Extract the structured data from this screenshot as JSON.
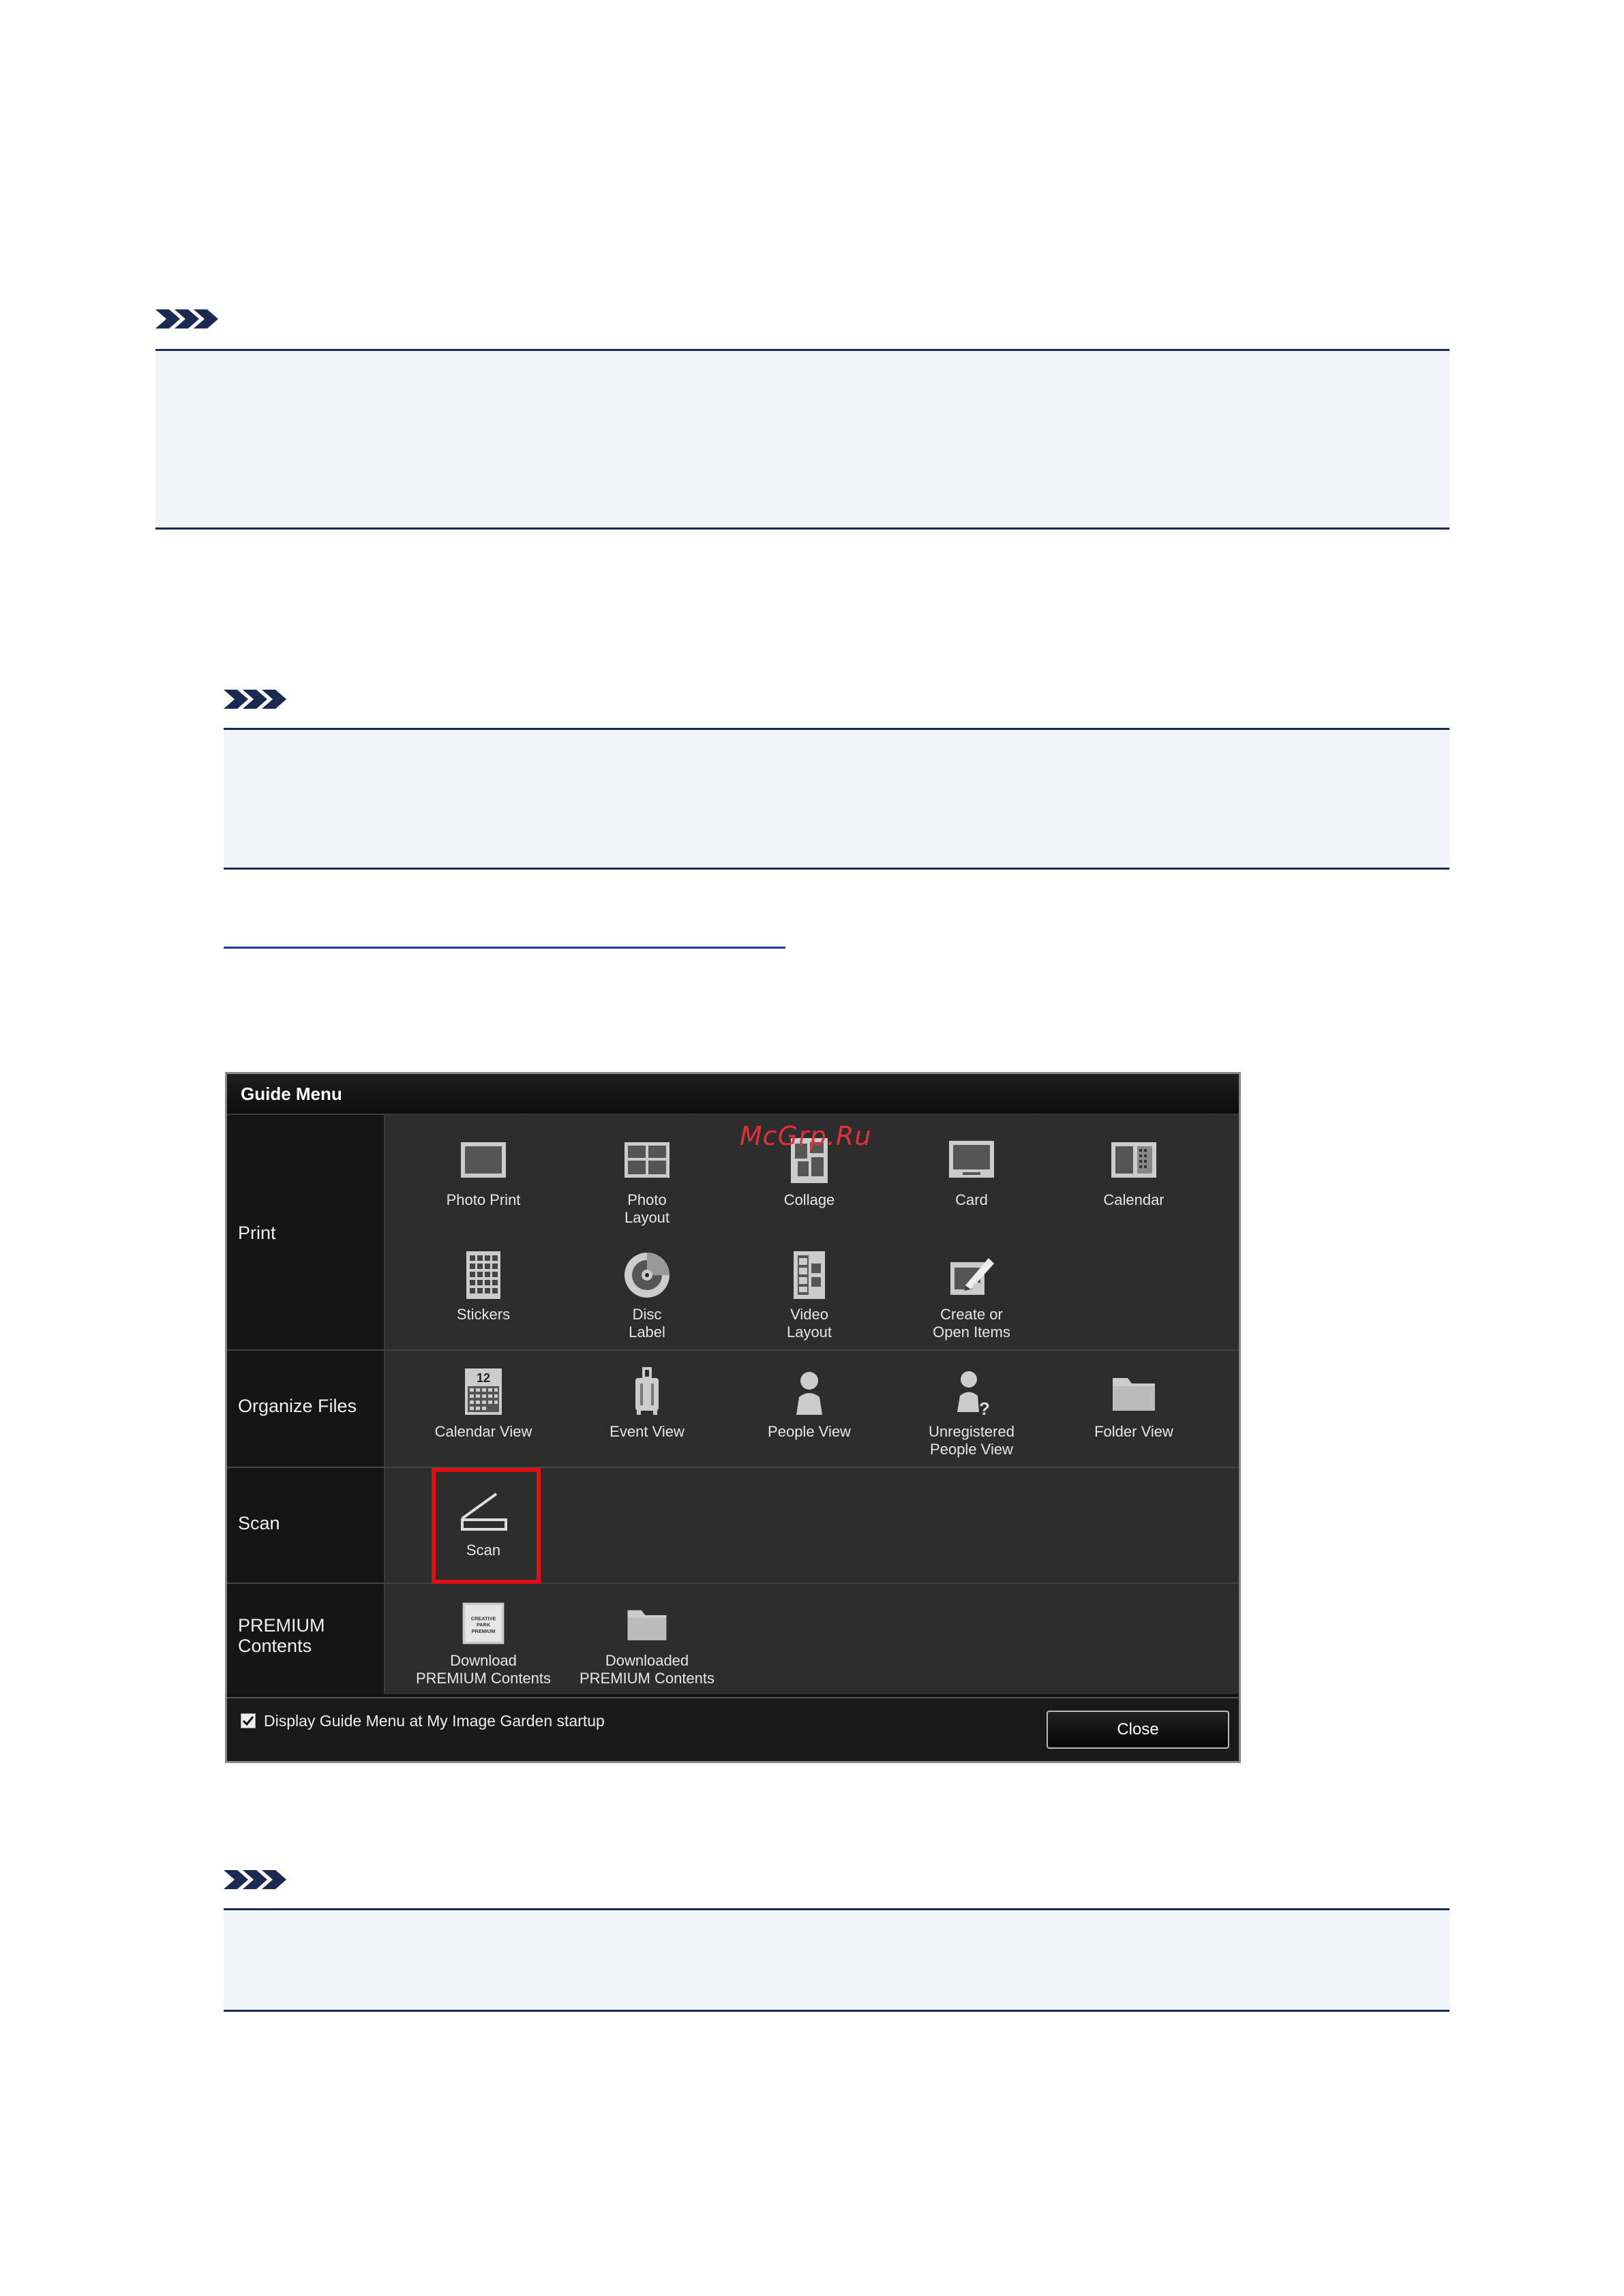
{
  "watermark": "McGrp.Ru",
  "dialog": {
    "title": "Guide Menu",
    "rows": [
      {
        "label": "Print",
        "items": [
          {
            "label": "Photo Print",
            "icon": "photo-print-icon"
          },
          {
            "label": "Photo\nLayout",
            "icon": "photo-layout-icon"
          },
          {
            "label": "Collage",
            "icon": "collage-icon"
          },
          {
            "label": "Card",
            "icon": "card-icon"
          },
          {
            "label": "Calendar",
            "icon": "calendar-icon"
          },
          {
            "label": "Stickers",
            "icon": "stickers-icon"
          },
          {
            "label": "Disc\nLabel",
            "icon": "disc-label-icon"
          },
          {
            "label": "Video\nLayout",
            "icon": "video-layout-icon"
          },
          {
            "label": "Create or\nOpen Items",
            "icon": "create-open-items-icon"
          }
        ]
      },
      {
        "label": "Organize Files",
        "items": [
          {
            "label": "Calendar View",
            "icon": "calendar-view-icon",
            "icon_text": "12"
          },
          {
            "label": "Event View",
            "icon": "event-view-icon"
          },
          {
            "label": "People View",
            "icon": "people-view-icon"
          },
          {
            "label": "Unregistered\nPeople View",
            "icon": "unregistered-people-view-icon"
          },
          {
            "label": "Folder View",
            "icon": "folder-view-icon"
          }
        ]
      },
      {
        "label": "Scan",
        "items": [
          {
            "label": "Scan",
            "icon": "scan-icon"
          }
        ]
      },
      {
        "label": "PREMIUM\nContents",
        "items": [
          {
            "label": "Download\nPREMIUM Contents",
            "icon": "creative-park-premium-icon",
            "icon_text": "CREATIVE PARK PREMIUM"
          },
          {
            "label": "Downloaded\nPREMIUM Contents",
            "icon": "downloaded-folder-icon"
          }
        ]
      }
    ],
    "footer": {
      "checkbox_label": "Display Guide Menu at My Image Garden startup",
      "checkbox_checked": true,
      "close_label": "Close"
    },
    "highlight_color": "#e01010"
  }
}
